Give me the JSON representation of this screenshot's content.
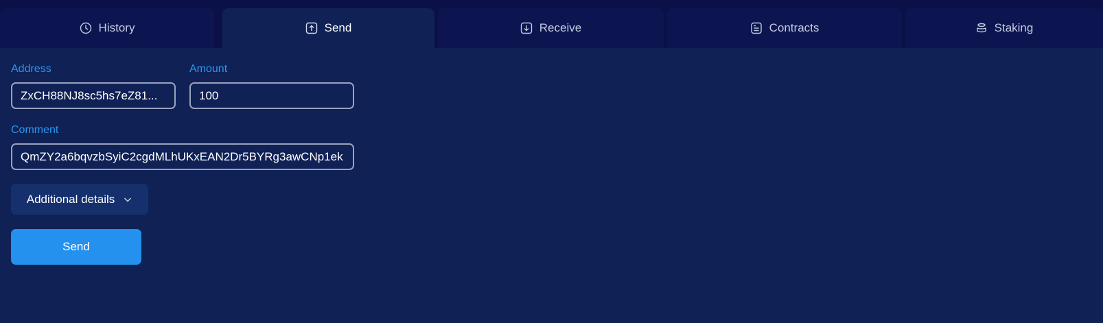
{
  "tabs": {
    "history": {
      "label": "History",
      "icon": "clock-icon"
    },
    "send": {
      "label": "Send",
      "icon": "upload-icon"
    },
    "receive": {
      "label": "Receive",
      "icon": "download-icon"
    },
    "contracts": {
      "label": "Contracts",
      "icon": "document-icon"
    },
    "staking": {
      "label": "Staking",
      "icon": "coins-icon"
    },
    "active": "Send"
  },
  "form": {
    "address_label": "Address",
    "address_value": "ZxCH88NJ8sc5hs7eZ81...",
    "amount_label": "Amount",
    "amount_value": "100",
    "comment_label": "Comment",
    "comment_value": "QmZY2a6bqvzbSyiC2cgdMLhUKxEAN2Dr5BYRg3awCNp1ek",
    "details_label": "Additional details",
    "send_label": "Send"
  },
  "colors": {
    "background": "#0f2155",
    "tabbar": "#0b1048",
    "accent_label": "#2a97f0",
    "send_button": "#2491ee",
    "details_button": "#15306d"
  }
}
